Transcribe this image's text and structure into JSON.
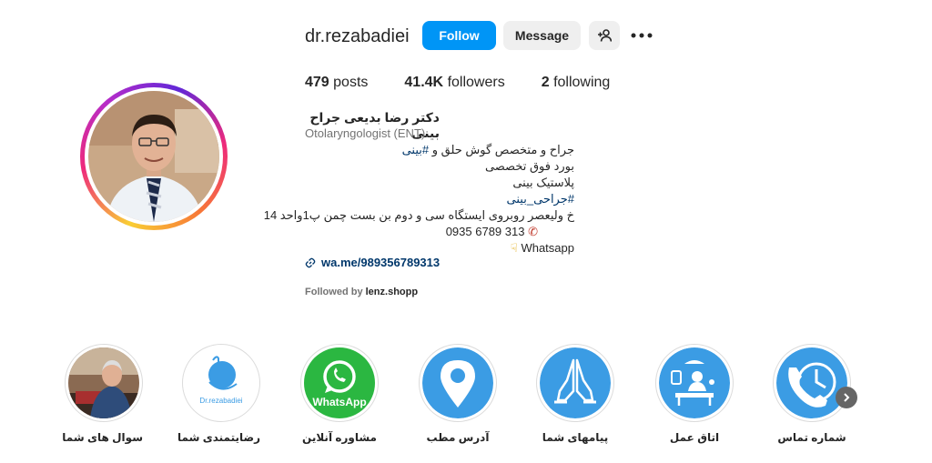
{
  "profile": {
    "username": "dr.rezabadiei",
    "follow_label": "Follow",
    "message_label": "Message",
    "posts_count": "479",
    "posts_label": "posts",
    "followers_count": "41.4K",
    "followers_label": "followers",
    "following_count": "2",
    "following_label": "following",
    "full_name": "دکتر رضا بدیعی جراح بینی",
    "category": "Otolaryngologist (ENT)",
    "bio_lines": [
      "جراح و متخصص گوش حلق و",
      "#بینی",
      "بورد فوق تخصصی",
      "پلاستیک بینی",
      "#جراحی_بینی",
      "خ ولیعصر روبروی ایستگاه سی و دوم بن بست چمن پ1واحد 14",
      "0935 6789 313",
      "Whatsapp"
    ],
    "link": "wa.me/989356789313",
    "followed_by_prefix": "Followed by",
    "followed_by_name": "lenz.shopp"
  },
  "highlights": [
    {
      "label": "سوال های شما",
      "icon": "doctor-photo"
    },
    {
      "label": "رضایتمندی شما",
      "icon": "brand-logo",
      "logo_text": "Dr.rezabadiei"
    },
    {
      "label": "مشاوره آنلاین",
      "icon": "whatsapp-icon",
      "logo_text": "WhatsApp"
    },
    {
      "label": "آدرس مطب",
      "icon": "location-pin-icon"
    },
    {
      "label": "پیامهای شما",
      "icon": "praying-hands-icon"
    },
    {
      "label": "اتاق عمل",
      "icon": "operating-room-icon"
    },
    {
      "label": "شماره تماس",
      "icon": "phone-clock-icon"
    }
  ],
  "colors": {
    "follow_button": "#0095f6",
    "secondary_button": "#efefef",
    "link": "#00376b",
    "highlight_blue": "#3b9ce4",
    "whatsapp_green": "#2bb741"
  }
}
